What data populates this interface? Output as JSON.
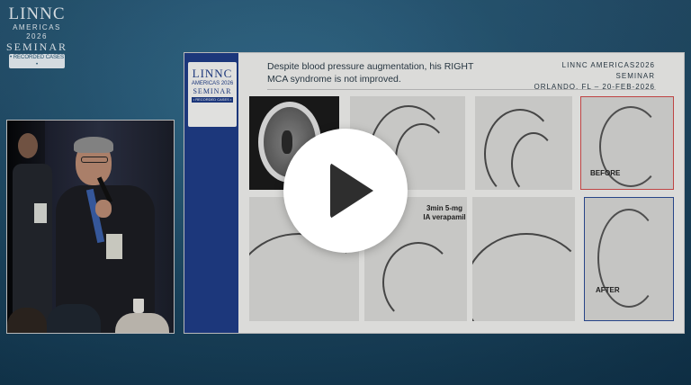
{
  "branding": {
    "logo_main": "LINNC",
    "logo_sub": "AMERICAS 2026",
    "logo_seminar": "SEMINAR",
    "logo_recorded": "• RECORDED CASES •"
  },
  "slide": {
    "logo_main": "LINNC",
    "logo_sub": "AMERICAS 2026",
    "logo_seminar": "SEMINAR",
    "logo_recorded": "• RECORDED CASES •",
    "heading": "Despite blood pressure augmentation, his RIGHT MCA syndrome is not improved.",
    "event_line1": "LINNC AMERICAS2026 SEMINAR",
    "event_line2": "ORLANDO, FL – 20-FEB-2026",
    "label_before": "BEFORE",
    "label_after": "AFTER",
    "label_verapamil": "3min 5-mg IA verapamil"
  },
  "player": {
    "play_icon": "play-icon",
    "accent": "#ffffff",
    "slide_strip_color": "#1f3c86"
  }
}
